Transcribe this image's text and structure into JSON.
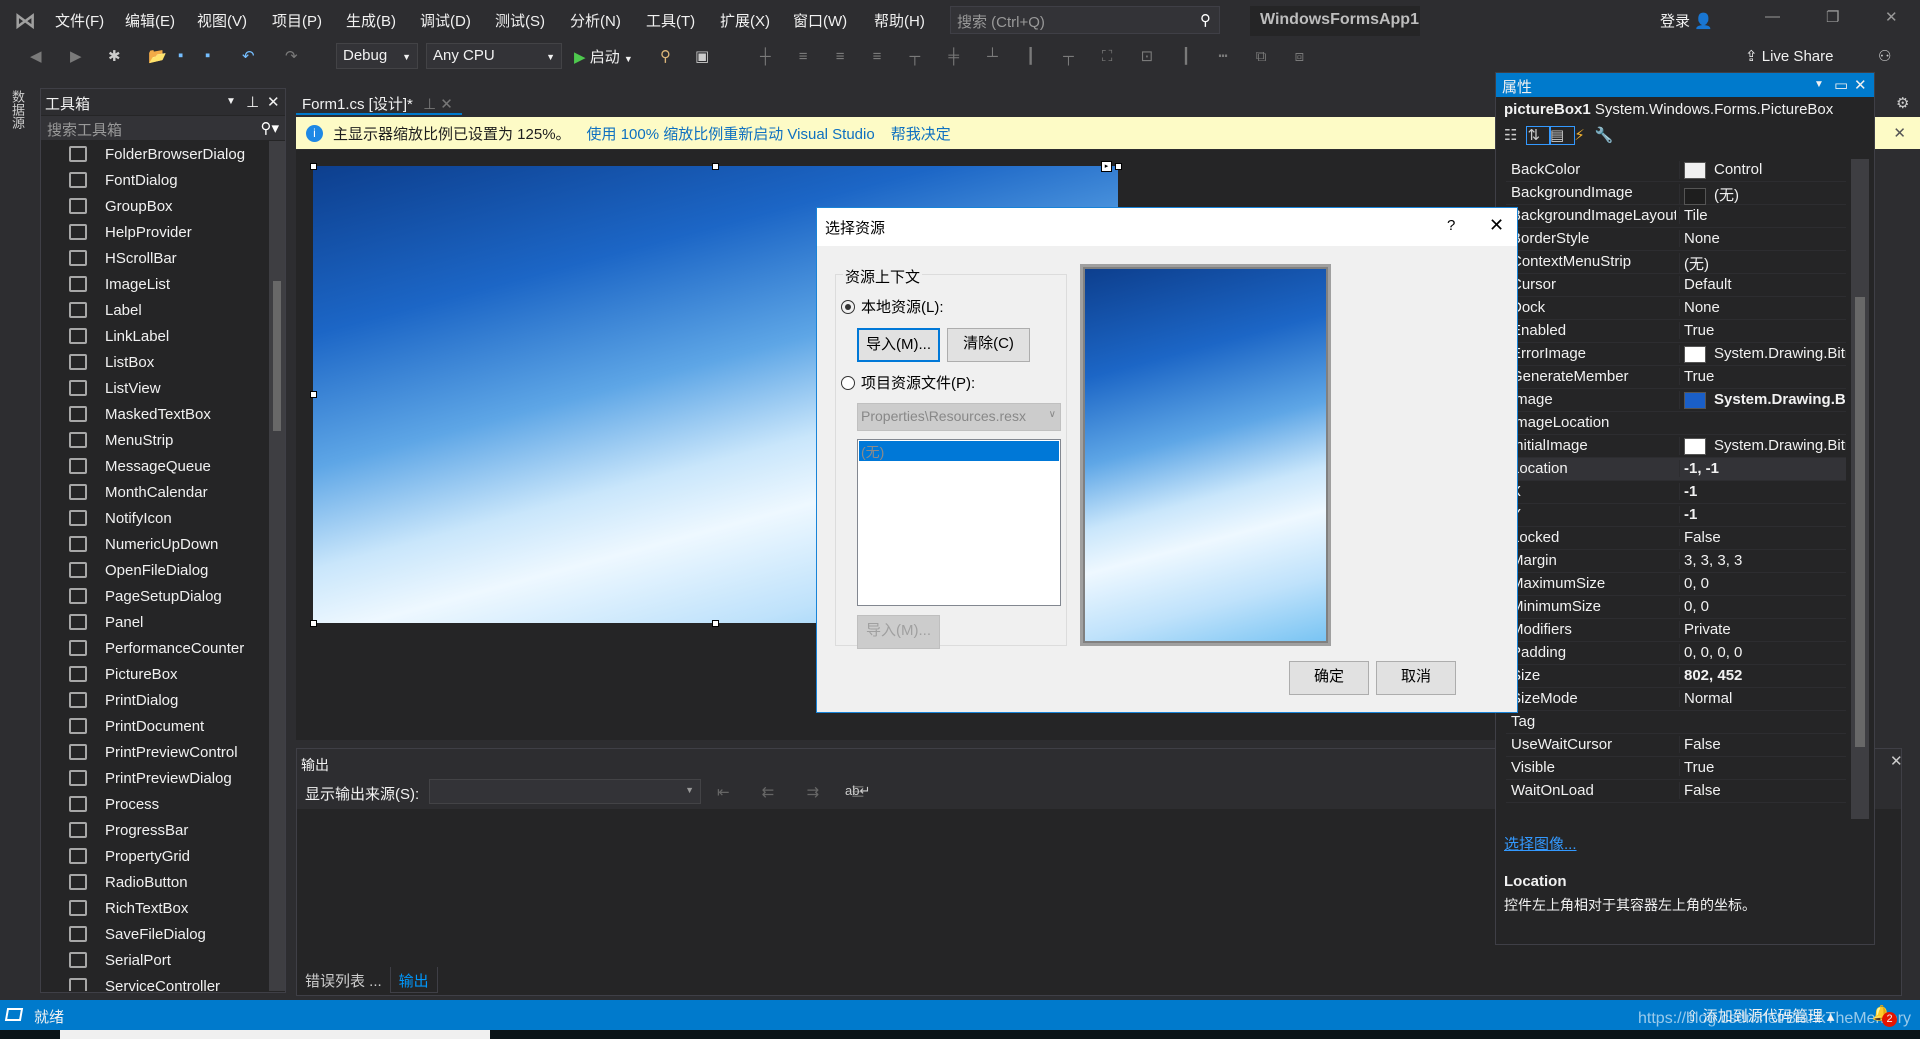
{
  "menu": {
    "items": [
      "文件(F)",
      "编辑(E)",
      "视图(V)",
      "项目(P)",
      "生成(B)",
      "调试(D)",
      "测试(S)",
      "分析(N)",
      "工具(T)",
      "扩展(X)",
      "窗口(W)",
      "帮助(H)"
    ],
    "search_placeholder": "搜索 (Ctrl+Q)",
    "app_title": "WindowsFormsApp1",
    "login": "登录"
  },
  "toolbar": {
    "config": "Debug",
    "platform": "Any CPU",
    "start": "启动",
    "live_share": "Live Share"
  },
  "left_rail": {
    "label": "数据源"
  },
  "toolbox": {
    "title": "工具箱",
    "search_placeholder": "搜索工具箱",
    "items": [
      "FolderBrowserDialog",
      "FontDialog",
      "GroupBox",
      "HelpProvider",
      "HScrollBar",
      "ImageList",
      "Label",
      "LinkLabel",
      "ListBox",
      "ListView",
      "MaskedTextBox",
      "MenuStrip",
      "MessageQueue",
      "MonthCalendar",
      "NotifyIcon",
      "NumericUpDown",
      "OpenFileDialog",
      "PageSetupDialog",
      "Panel",
      "PerformanceCounter",
      "PictureBox",
      "PrintDialog",
      "PrintDocument",
      "PrintPreviewControl",
      "PrintPreviewDialog",
      "Process",
      "ProgressBar",
      "PropertyGrid",
      "RadioButton",
      "RichTextBox",
      "SaveFileDialog",
      "SerialPort",
      "ServiceController"
    ]
  },
  "document": {
    "tab": "Form1.cs [设计]*",
    "info_text": "主显示器缩放比例已设置为 125%。",
    "info_link1": "使用 100% 缩放比例重新启动 Visual Studio",
    "info_link2": "帮我决定"
  },
  "output": {
    "title": "输出",
    "source_label": "显示输出来源(S):",
    "tabs": [
      "错误列表 ...",
      "输出"
    ]
  },
  "properties": {
    "title": "属性",
    "object_name": "pictureBox1",
    "object_type": "System.Windows.Forms.PictureBox",
    "rows": [
      {
        "name": "BackColor",
        "value": "Control"
      },
      {
        "name": "BackgroundImage",
        "value": "(无)"
      },
      {
        "name": "BackgroundImageLayout",
        "value": "Tile"
      },
      {
        "name": "BorderStyle",
        "value": "None"
      },
      {
        "name": "ContextMenuStrip",
        "value": "(无)"
      },
      {
        "name": "Cursor",
        "value": "Default"
      },
      {
        "name": "Dock",
        "value": "None"
      },
      {
        "name": "Enabled",
        "value": "True"
      },
      {
        "name": "ErrorImage",
        "value": "System.Drawing.Bitmap"
      },
      {
        "name": "GenerateMember",
        "value": "True"
      },
      {
        "name": "Image",
        "value": "System.Drawing.Bitmap"
      },
      {
        "name": "ImageLocation",
        "value": ""
      },
      {
        "name": "InitialImage",
        "value": "System.Drawing.Bitmap"
      },
      {
        "name": "Location",
        "value": "-1, -1"
      },
      {
        "name": "X",
        "value": "-1"
      },
      {
        "name": "Y",
        "value": "-1"
      },
      {
        "name": "Locked",
        "value": "False"
      },
      {
        "name": "Margin",
        "value": "3, 3, 3, 3"
      },
      {
        "name": "MaximumSize",
        "value": "0, 0"
      },
      {
        "name": "MinimumSize",
        "value": "0, 0"
      },
      {
        "name": "Modifiers",
        "value": "Private"
      },
      {
        "name": "Padding",
        "value": "0, 0, 0, 0"
      },
      {
        "name": "Size",
        "value": "802, 452"
      },
      {
        "name": "SizeMode",
        "value": "Normal"
      },
      {
        "name": "Tag",
        "value": ""
      },
      {
        "name": "UseWaitCursor",
        "value": "False"
      },
      {
        "name": "Visible",
        "value": "True"
      },
      {
        "name": "WaitOnLoad",
        "value": "False"
      }
    ],
    "link": "选择图像...",
    "desc_title": "Location",
    "desc_text": "控件左上角相对于其容器左上角的坐标。"
  },
  "dialog": {
    "title": "选择资源",
    "help": "?",
    "group": "资源上下文",
    "local": "本地资源(L):",
    "import": "导入(M)...",
    "clear": "清除(C)",
    "project": "项目资源文件(P):",
    "resx": "Properties\\Resources.resx",
    "list_item": "(无)",
    "import2": "导入(M)...",
    "ok": "确定",
    "cancel": "取消"
  },
  "status": {
    "text": "就绪",
    "source_control": "添加到源代码管理",
    "watermark": "https://blog.csdn.net/BlankTheMemory",
    "notifications": "2"
  },
  "colors": {
    "accent": "#007acc",
    "infobar": "#fdfbc6",
    "bg": "#2d2d30"
  }
}
